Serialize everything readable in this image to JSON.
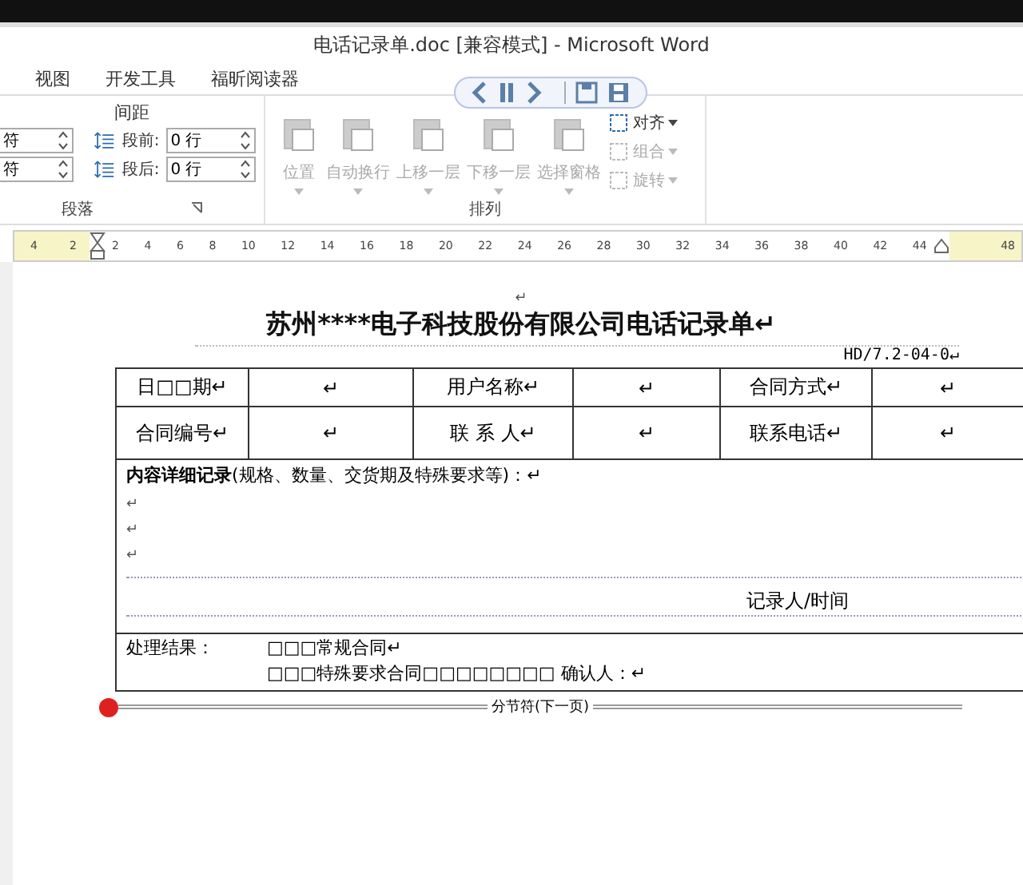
{
  "window": {
    "title": "电话记录单.doc [兼容模式] - Microsoft Word"
  },
  "tabs": [
    {
      "label": "视图"
    },
    {
      "label": "开发工具"
    },
    {
      "label": "福昕阅读器"
    }
  ],
  "spacing_group": {
    "heading": "间距",
    "fields": [
      {
        "value": "符"
      },
      {
        "label": "段前:",
        "value": "0 行"
      },
      {
        "value": "符"
      },
      {
        "label": "段后:",
        "value": "0 行"
      }
    ],
    "group_label": "段落"
  },
  "arrange_group": {
    "large_buttons": [
      {
        "label": "位置",
        "disabled": true
      },
      {
        "label": "自动换行",
        "disabled": true
      },
      {
        "label": "上移一层",
        "disabled": true
      },
      {
        "label": "下移一层",
        "disabled": true
      },
      {
        "label": "选择窗格",
        "disabled": true
      }
    ],
    "small_buttons": [
      {
        "label": "对齐",
        "disabled": false
      },
      {
        "label": "组合",
        "disabled": true
      },
      {
        "label": "旋转",
        "disabled": true
      }
    ],
    "group_label": "排列"
  },
  "ruler": {
    "left_ticks": [
      "4",
      "2"
    ],
    "ticks": [
      "2",
      "4",
      "6",
      "8",
      "10",
      "12",
      "14",
      "16",
      "18",
      "20",
      "22",
      "24",
      "26",
      "28",
      "30",
      "32",
      "34",
      "36",
      "38",
      "40",
      "42",
      "44"
    ],
    "right_ticks": [
      "48"
    ]
  },
  "document": {
    "blank_mark": "↵",
    "title": "苏州****电子科技股份有限公司电话记录单↵",
    "code": "HD/7.2-04-0↵",
    "rows": [
      [
        "日□□期↵",
        "↵",
        "用户名称↵",
        "↵",
        "合同方式↵",
        "↵"
      ],
      [
        "合同编号↵",
        "↵",
        "联 系 人↵",
        "↵",
        "联系电话↵",
        "↵"
      ]
    ],
    "details": "**内容详细记录**(规格、数量、交货期及特殊要求等)：↵",
    "blank_lines": [
      "↵",
      "↵",
      "↵"
    ],
    "recorder": "记录人/时间",
    "result_label": "处理结果：",
    "options": [
      "□□□常规合同↵",
      "□□□特殊要求合同□□□□□□□□ 确认人：↵"
    ],
    "section_break": "分节符(下一页)"
  }
}
